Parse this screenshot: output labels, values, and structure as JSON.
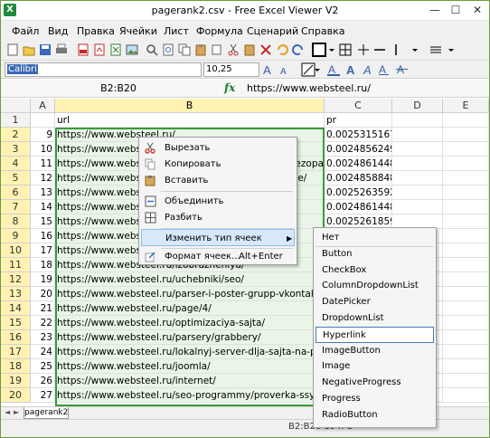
{
  "window": {
    "title": "pagerank2.csv - Free Excel Viewer V2",
    "logo": "X",
    "min": "—",
    "max": "☐",
    "close": "✕"
  },
  "menu": [
    "Файл",
    "Вид",
    "Правка",
    "Ячейки",
    "Лист",
    "Формула",
    "Сценарий",
    "Справка"
  ],
  "font": {
    "name": "Calibri",
    "size": "10,25"
  },
  "formula": {
    "cellref": "B2:B20",
    "fx": "fx",
    "value": "https://www.websteel.ru/"
  },
  "columns": [
    "A",
    "B",
    "C",
    "D",
    "E"
  ],
  "rows": [
    {
      "num": "1",
      "a": "",
      "b": "url",
      "c": "pr"
    },
    {
      "num": "2",
      "a": "9",
      "b": "https://www.websteel.ru/",
      "c": "0.00253151677981675"
    },
    {
      "num": "3",
      "a": "10",
      "b": "https://www.websteel.ru/",
      "c": "0.00248562491985634"
    },
    {
      "num": "4",
      "a": "11",
      "b": "https://www.websteel.ru/________________________bezopas",
      "c": "0.00248614480764376"
    },
    {
      "num": "5",
      "a": "12",
      "b": "https://www.websteel.ru/________________________nie/",
      "c": "0.00248588486375005"
    },
    {
      "num": "6",
      "a": "13",
      "b": "https://www.websteel.ru/",
      "c": "0.00252635927240777"
    },
    {
      "num": "7",
      "a": "14",
      "b": "https://www.websteel.ru/",
      "c": "0.00248614480764376"
    },
    {
      "num": "8",
      "a": "15",
      "b": "https://www.websteel.ru/",
      "c": "0.00252618597647863"
    },
    {
      "num": "9",
      "a": "16",
      "b": "https://www.websteel.ru/",
      "c": ""
    },
    {
      "num": "10",
      "a": "17",
      "b": "https://www.websteel.ru/",
      "c": ""
    },
    {
      "num": "11",
      "a": "18",
      "b": "https://www.websteel.ru/izobrazheniya/",
      "c": ""
    },
    {
      "num": "12",
      "a": "19",
      "b": "https://www.websteel.ru/uchebniki/seo/",
      "c": ""
    },
    {
      "num": "13",
      "a": "20",
      "b": "https://www.websteel.ru/parser-i-poster-grupp-vkontakte",
      "c": ""
    },
    {
      "num": "14",
      "a": "21",
      "b": "https://www.websteel.ru/page/4/",
      "c": ""
    },
    {
      "num": "15",
      "a": "22",
      "b": "https://www.websteel.ru/optimizaciya-sajta/",
      "c": ""
    },
    {
      "num": "16",
      "a": "23",
      "b": "https://www.websteel.ru/parsery/grabbery/",
      "c": ""
    },
    {
      "num": "17",
      "a": "24",
      "b": "https://www.websteel.ru/lokalnyj-server-dlja-sajta-na-pk-h",
      "c": ""
    },
    {
      "num": "18",
      "a": "25",
      "b": "https://www.websteel.ru/joomla/",
      "c": ""
    },
    {
      "num": "19",
      "a": "26",
      "b": "https://www.websteel.ru/internet/",
      "c": ""
    },
    {
      "num": "20",
      "a": "27",
      "b": "https://www.websteel.ru/seo-programmy/proverka-ssylok/",
      "c": ""
    }
  ],
  "sheet": {
    "tab": "pagerank2",
    "nav_prev": "◄",
    "nav_next": "►"
  },
  "status": "B2:B20 19 x 1",
  "context_menu": {
    "cut": "Вырезать",
    "copy": "Копировать",
    "paste": "Вставить",
    "merge": "Объединить",
    "split": "Разбить",
    "change_type": "Изменить тип ячеек",
    "format": "Формат ячеек...",
    "format_shortcut": "Alt+Enter"
  },
  "submenu": [
    "Нет",
    "Button",
    "CheckBox",
    "ColumnDropdownList",
    "DatePicker",
    "DropdownList",
    "Hyperlink",
    "ImageButton",
    "Image",
    "NegativeProgress",
    "Progress",
    "RadioButton"
  ],
  "colors": {
    "accent": "#3a9a3a",
    "selection": "#e9f5e6",
    "header_sel": "#fff2b3"
  }
}
